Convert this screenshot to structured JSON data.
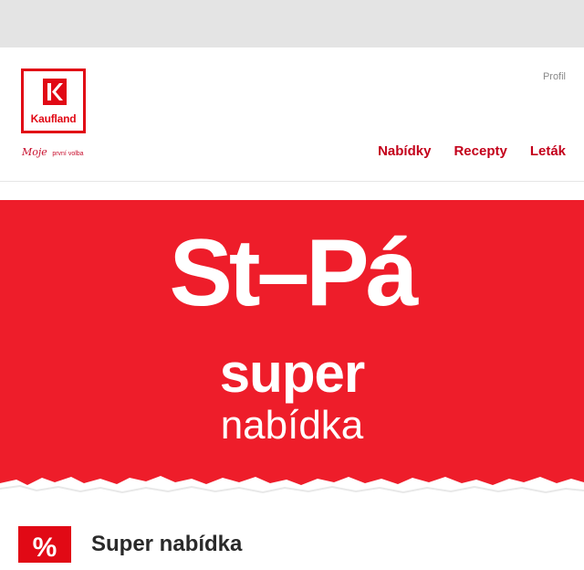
{
  "header": {
    "logo_text": "Kaufland",
    "tagline_main": "Moje",
    "tagline_small": "první volba",
    "profile_label": "Profil",
    "nav": [
      {
        "label": "Nabídky"
      },
      {
        "label": "Recepty"
      },
      {
        "label": "Leták"
      }
    ]
  },
  "hero": {
    "big_text": "St–Pá",
    "super_text": "super",
    "nabidka_text": "nabídka",
    "background_color": "#ee1d2a"
  },
  "offer": {
    "badge": "%",
    "title": "Super nabídka"
  },
  "colors": {
    "brand_red": "#e10915",
    "nav_red": "#c3001a"
  }
}
